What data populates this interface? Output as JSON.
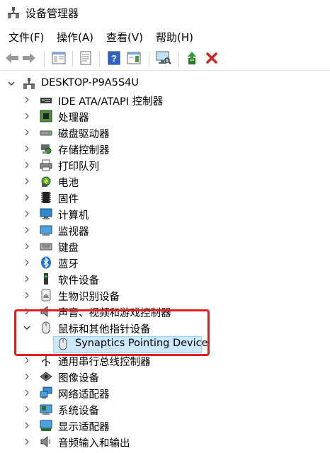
{
  "window": {
    "title": "设备管理器"
  },
  "menu": {
    "file": "文件(F)",
    "action": "操作(A)",
    "view": "查看(V)",
    "help": "帮助(H)"
  },
  "tree": {
    "root": "DESKTOP-P9A5S4U",
    "items": [
      "IDE ATA/ATAPI 控制器",
      "处理器",
      "磁盘驱动器",
      "存储控制器",
      "打印队列",
      "电池",
      "固件",
      "计算机",
      "监视器",
      "键盘",
      "蓝牙",
      "软件设备",
      "生物识别设备",
      "声音、视频和游戏控制器",
      "鼠标和其他指针设备",
      "Synaptics Pointing Device",
      "通用串行总线控制器",
      "图像设备",
      "网络适配器",
      "系统设备",
      "显示适配器",
      "音频输入和输出"
    ]
  }
}
